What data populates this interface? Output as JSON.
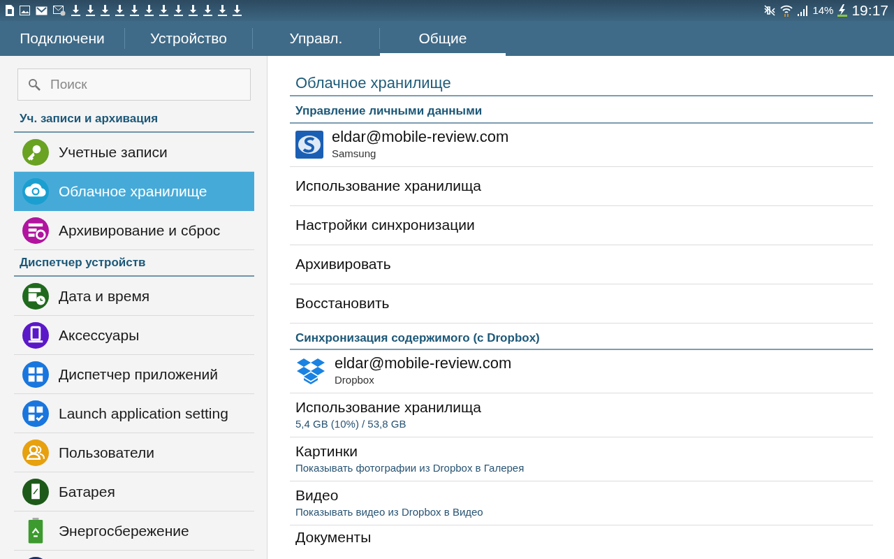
{
  "status_bar": {
    "notification_icons": [
      {
        "kind": "sim"
      },
      {
        "kind": "image"
      },
      {
        "kind": "mail"
      },
      {
        "kind": "mail-settings"
      },
      {
        "kind": "download"
      },
      {
        "kind": "download"
      },
      {
        "kind": "download"
      },
      {
        "kind": "download"
      },
      {
        "kind": "download"
      },
      {
        "kind": "download"
      },
      {
        "kind": "download"
      },
      {
        "kind": "download"
      },
      {
        "kind": "download"
      },
      {
        "kind": "download"
      },
      {
        "kind": "download"
      },
      {
        "kind": "download"
      }
    ],
    "battery_percent": "14%",
    "time": "19:17"
  },
  "tabs": [
    {
      "label": "Подключени",
      "selected": false
    },
    {
      "label": "Устройство",
      "selected": false
    },
    {
      "label": "Управл.",
      "selected": false
    },
    {
      "label": "Общие",
      "selected": true
    }
  ],
  "search": {
    "placeholder": "Поиск"
  },
  "sidebar": [
    {
      "kind": "header",
      "label": "Уч. записи и архивация"
    },
    {
      "kind": "item",
      "label": "Учетные записи",
      "color": "#6aa222",
      "selected": false
    },
    {
      "kind": "item",
      "label": "Облачное хранилище",
      "color": "#1a9fd0",
      "selected": true
    },
    {
      "kind": "item",
      "label": "Архивирование и сброс",
      "color": "#b1149f",
      "selected": false
    },
    {
      "kind": "header",
      "label": "Диспетчер устройств"
    },
    {
      "kind": "item",
      "label": "Дата и время",
      "color": "#1f6a1c",
      "selected": false
    },
    {
      "kind": "item",
      "label": "Аксессуары",
      "color": "#5b18c8",
      "selected": false
    },
    {
      "kind": "item",
      "label": "Диспетчер приложений",
      "color": "#1876de",
      "selected": false
    },
    {
      "kind": "item",
      "label": "Launch application setting",
      "color": "#1876de",
      "selected": false
    },
    {
      "kind": "item",
      "label": "Пользователи",
      "color": "#e7a00e",
      "selected": false
    },
    {
      "kind": "item",
      "label": "Батарея",
      "color": "#1d5a1a",
      "selected": false
    },
    {
      "kind": "item",
      "label": "Энергосбережение",
      "color": "#3c9a2e",
      "selected": false
    }
  ],
  "content": {
    "title": "Облачное хранилище",
    "sections": [
      {
        "header": "Управление личными данными",
        "rows": [
          {
            "kind": "account",
            "title": "eldar@mobile-review.com",
            "subtitle": "Samsung"
          },
          {
            "kind": "plain",
            "title": "Использование хранилища"
          },
          {
            "kind": "plain",
            "title": "Настройки синхронизации"
          },
          {
            "kind": "plain",
            "title": "Архивировать"
          },
          {
            "kind": "plain",
            "title": "Восстановить"
          }
        ]
      },
      {
        "header": "Синхронизация содержимого (с Dropbox)",
        "rows": [
          {
            "kind": "account",
            "title": "eldar@mobile-review.com",
            "subtitle": "Dropbox"
          },
          {
            "kind": "detail",
            "title": "Использование хранилища",
            "subtitle": "5,4 GB (10%) / 53,8 GB"
          },
          {
            "kind": "detail",
            "title": "Картинки",
            "subtitle": "Показывать фотографии из Dropbox в Галерея"
          },
          {
            "kind": "detail",
            "title": "Видео",
            "subtitle": "Показывать видео из Dropbox в Видео"
          },
          {
            "kind": "detail",
            "title": "Документы"
          }
        ]
      }
    ]
  }
}
